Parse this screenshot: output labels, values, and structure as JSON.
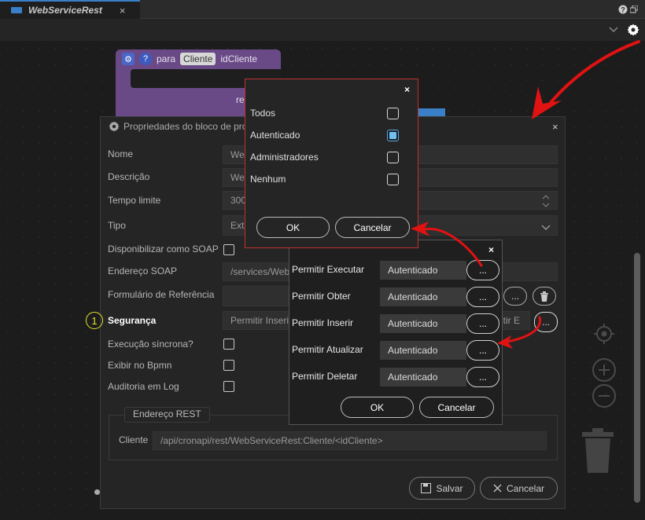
{
  "tab": {
    "title": "WebServiceRest",
    "close": "×"
  },
  "block": {
    "prefix": "para",
    "chip": "Cliente",
    "param": "idCliente",
    "fragment": "re"
  },
  "props": {
    "title": "Propriedades do bloco de pro",
    "close": "×",
    "labels": {
      "nome": "Nome",
      "descricao": "Descrição",
      "tempo": "Tempo limite",
      "tipo": "Tipo",
      "soap_disp": "Disponibilizar como SOAP",
      "soap_end": "Endereço SOAP",
      "form_ref": "Formulário de Referência",
      "seguranca": "Segurança",
      "exec_sinc": "Execução síncrona?",
      "bpmn": "Exibir no Bpmn",
      "auditoria": "Auditoria em Log"
    },
    "values": {
      "nome": "Web",
      "descricao": "We",
      "tempo": "300",
      "tipo": "Ext",
      "soap_end": "/services/Web",
      "seg_left": "Permitir Inseri",
      "seg_right": "itir E"
    },
    "rest_legend": "Endereço REST",
    "cliente_label": "Cliente",
    "cliente_url": "/api/cronapi/rest/WebServiceRest:Cliente/<idCliente>",
    "save": "Salvar",
    "cancel": "Cancelar",
    "ellipsis": "..."
  },
  "step_number": "1",
  "roles": {
    "close": "×",
    "items": [
      {
        "label": "Todos",
        "checked": false
      },
      {
        "label": "Autenticado",
        "checked": true
      },
      {
        "label": "Administradores",
        "checked": false
      },
      {
        "label": "Nenhum",
        "checked": false
      }
    ],
    "ok": "OK",
    "cancel": "Cancelar"
  },
  "perms": {
    "close": "×",
    "rows": [
      {
        "label": "Permitir Executar",
        "value": "Autenticado"
      },
      {
        "label": "Permitir Obter",
        "value": "Autenticado"
      },
      {
        "label": "Permitir Inserir",
        "value": "Autenticado"
      },
      {
        "label": "Permitir Atualizar",
        "value": "Autenticado"
      },
      {
        "label": "Permitir Deletar",
        "value": "Autenticado"
      }
    ],
    "btn": "...",
    "ok": "OK",
    "cancel": "Cancelar"
  },
  "colors": {
    "arrow": "#e11212",
    "roles_border": "#c0302f",
    "accent": "#3a80c9",
    "step": "#e4e42b"
  },
  "icons": [
    "help-icon",
    "settings-gear-icon",
    "chevron-down-icon",
    "trash-icon",
    "zoom-in-icon",
    "zoom-out-icon",
    "recenter-icon"
  ]
}
